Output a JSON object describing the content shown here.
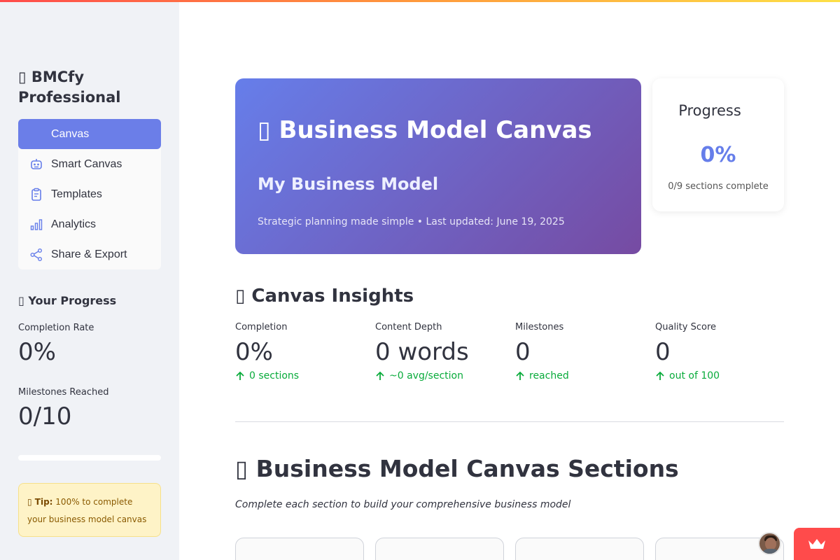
{
  "sidebar": {
    "brand_line1": "▯ BMCfy",
    "brand_line2": "Professional",
    "nav": [
      {
        "label": "Canvas",
        "icon": "canvas-icon",
        "active": true
      },
      {
        "label": "Smart Canvas",
        "icon": "robot-icon",
        "active": false
      },
      {
        "label": "Templates",
        "icon": "clipboard-icon",
        "active": false
      },
      {
        "label": "Analytics",
        "icon": "bar-chart-icon",
        "active": false
      },
      {
        "label": "Share & Export",
        "icon": "share-icon",
        "active": false
      }
    ],
    "progress_title": "▯ Your Progress",
    "completion_label": "Completion Rate",
    "completion_value": "0%",
    "milestones_label": "Milestones Reached",
    "milestones_value": "0/10",
    "progress_fraction": 0,
    "tip_prefix": "▯ Tip:",
    "tip_text": "100% to complete your business model canvas"
  },
  "hero": {
    "title": "▯ Business Model Canvas",
    "subtitle": "My Business Model",
    "tagline": "Strategic planning made simple • Last updated: June 19, 2025"
  },
  "progress_card": {
    "title": "Progress",
    "value": "0%",
    "sub": "0/9 sections complete"
  },
  "insights": {
    "title": "▯ Canvas Insights",
    "metrics": [
      {
        "label": "Completion",
        "value": "0%",
        "delta": "0 sections"
      },
      {
        "label": "Content Depth",
        "value": "0 words",
        "delta": "~0 avg/section"
      },
      {
        "label": "Milestones",
        "value": "0",
        "delta": "reached"
      },
      {
        "label": "Quality Score",
        "value": "0",
        "delta": "out of 100"
      }
    ]
  },
  "sections": {
    "title": "▯ Business Model Canvas Sections",
    "subtitle": "Complete each section to build your comprehensive business model"
  },
  "colors": {
    "accent": "#667eea",
    "accent_dark": "#764ba2",
    "positive": "#09ab3b",
    "streamlit_red": "#ff4b4b"
  }
}
